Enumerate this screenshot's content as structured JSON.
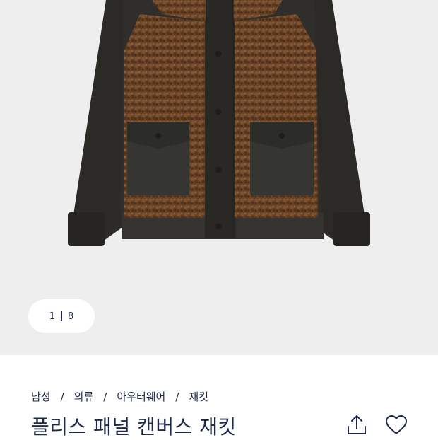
{
  "gallery": {
    "current_index": "1",
    "total_count": "8",
    "image_alt": "플리스 패널 캔버스 재킷"
  },
  "breadcrumb": [
    "남성",
    "의류",
    "아우터웨어",
    "재킷"
  ],
  "product": {
    "title": "플리스 패널 캔버스 재킷"
  },
  "actions": {
    "share_icon": "share-icon",
    "favorite_icon": "heart-icon"
  },
  "colors": {
    "gallery_bg": "#eeeeee",
    "text_navy": "#1c2a4a"
  }
}
